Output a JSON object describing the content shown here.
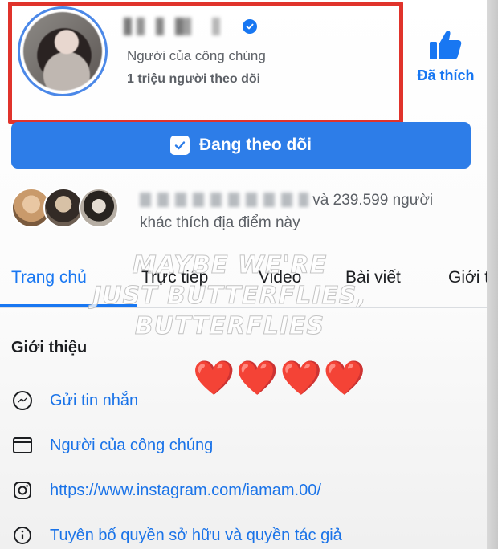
{
  "profile": {
    "category": "Người của công chúng",
    "followers": "1 triệu người theo dõi",
    "like_label": "Đã thích",
    "follow_button_label": "Đang theo dõi"
  },
  "friends": {
    "text_suffix": "và 239.599 người",
    "text_line2": "khác thích địa điểm này"
  },
  "tabs": [
    {
      "label": "Trang chủ",
      "active": true
    },
    {
      "label": "Trực tiếp"
    },
    {
      "label": "Video"
    },
    {
      "label": "Bài viết"
    },
    {
      "label": "Giới t"
    }
  ],
  "overlay": {
    "line1": "MAYBE WE'RE",
    "line2": "JUST BUTTERFLIES,",
    "line3": "BUTTERFLIES"
  },
  "about": {
    "title": "Giới thiệu",
    "hearts": "❤️❤️❤️❤️",
    "items": [
      {
        "icon": "messenger-icon",
        "text": "Gửi tin nhắn"
      },
      {
        "icon": "category-icon",
        "text": "Người của công chúng"
      },
      {
        "icon": "instagram-icon",
        "text": "https://www.instagram.com/iamam.00/"
      },
      {
        "icon": "info-icon",
        "text": "Tuyên bố quyền sở hữu và quyền tác giả"
      }
    ]
  },
  "colors": {
    "accent": "#1877f2",
    "highlight_border": "#e0332b",
    "follow_button": "#2d7de8"
  }
}
